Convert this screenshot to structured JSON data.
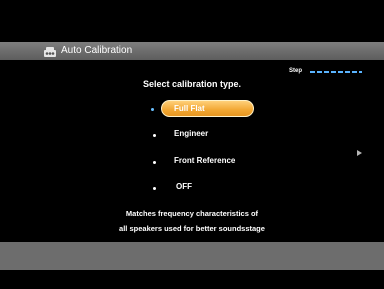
{
  "title_bar": {
    "icon": "speaker-calibration-icon",
    "title": "Auto Calibration"
  },
  "panel": {
    "heading": "Select calibration type.",
    "step_label": "Step",
    "options": [
      {
        "label": "Full Flat",
        "selected": true
      },
      {
        "label": "Engineer",
        "selected": false
      },
      {
        "label": "Front Reference",
        "selected": false
      },
      {
        "label": "OFF",
        "selected": false
      }
    ],
    "description_line1": "Matches frequency characteristics of",
    "description_line2": "all speakers used for better soundsstage"
  },
  "colors": {
    "highlight": "#f2a733",
    "step_accent": "#5ab4ff",
    "title_bar": "#6e6e6e",
    "background": "#000000"
  }
}
